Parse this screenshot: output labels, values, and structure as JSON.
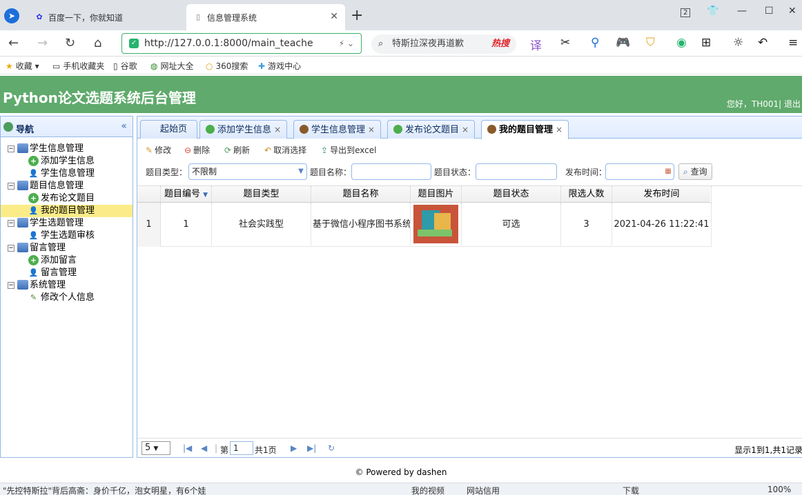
{
  "browser": {
    "tabs": [
      {
        "label": "百度一下，你就知道",
        "icon": "baidu-paw-icon"
      },
      {
        "label": "信息管理系统",
        "icon": "page-icon"
      }
    ],
    "url": "http://127.0.0.1:8000/main_teache",
    "search_text": "特斯拉深夜再道歉",
    "search_badge": "热搜",
    "tab_count": "2",
    "bookmarks": [
      "收藏",
      "手机收藏夹",
      "谷歌",
      "网址大全",
      "360搜索",
      "游戏中心"
    ]
  },
  "app": {
    "title": "Python论文选题系统后台管理",
    "user_text": "您好，TH001| 退出",
    "header_color": "#5faa6c"
  },
  "nav": {
    "title": "导航",
    "groups": [
      {
        "label": "学生信息管理",
        "children": [
          {
            "label": "添加学生信息",
            "icon": "plus-icon"
          },
          {
            "label": "学生信息管理",
            "icon": "person-icon"
          }
        ]
      },
      {
        "label": "题目信息管理",
        "children": [
          {
            "label": "发布论文题目",
            "icon": "plus-icon"
          },
          {
            "label": "我的题目管理",
            "icon": "person-icon",
            "selected": true
          }
        ]
      },
      {
        "label": "学生选题管理",
        "children": [
          {
            "label": "学生选题审核",
            "icon": "person-icon"
          }
        ]
      },
      {
        "label": "留言管理",
        "children": [
          {
            "label": "添加留言",
            "icon": "plus-icon"
          },
          {
            "label": "留言管理",
            "icon": "person-icon"
          }
        ]
      },
      {
        "label": "系统管理",
        "children": [
          {
            "label": "修改个人信息",
            "icon": "pencil-icon"
          }
        ]
      }
    ]
  },
  "tabs": [
    {
      "label": "起始页",
      "closable": false
    },
    {
      "label": "添加学生信息",
      "closable": true
    },
    {
      "label": "学生信息管理",
      "closable": true
    },
    {
      "label": "发布论文题目",
      "closable": true
    },
    {
      "label": "我的题目管理",
      "closable": true,
      "active": true
    }
  ],
  "toolbar": {
    "edit": "修改",
    "delete": "删除",
    "refresh": "刷新",
    "cancel_select": "取消选择",
    "export": "导出到excel"
  },
  "filters": {
    "type_label": "题目类型：",
    "type_value": "不限制",
    "name_label": "题目名称：",
    "status_label": "题目状态：",
    "time_label": "发布时间：",
    "query_button": "查询"
  },
  "grid": {
    "columns": [
      "题目编号",
      "题目类型",
      "题目名称",
      "题目图片",
      "题目状态",
      "限选人数",
      "发布时间"
    ],
    "rows": [
      {
        "index": "1",
        "id": "1",
        "type": "社会实践型",
        "name": "基于微信小程序图书系统",
        "status": "可选",
        "limit": "3",
        "time": "2021-04-26 11:22:41"
      }
    ]
  },
  "pager": {
    "page_size": "5",
    "page_label": "第",
    "page_value": "1",
    "total_pages": "共1页",
    "info": "显示1到1,共1记录"
  },
  "footer": "© Powered by dashen",
  "statusbar": [
    "\"先控特斯拉\"背后高斋：身价千亿，泡女明星，有6个娃",
    "我的视频",
    "网站信用",
    "下载",
    "100%"
  ]
}
